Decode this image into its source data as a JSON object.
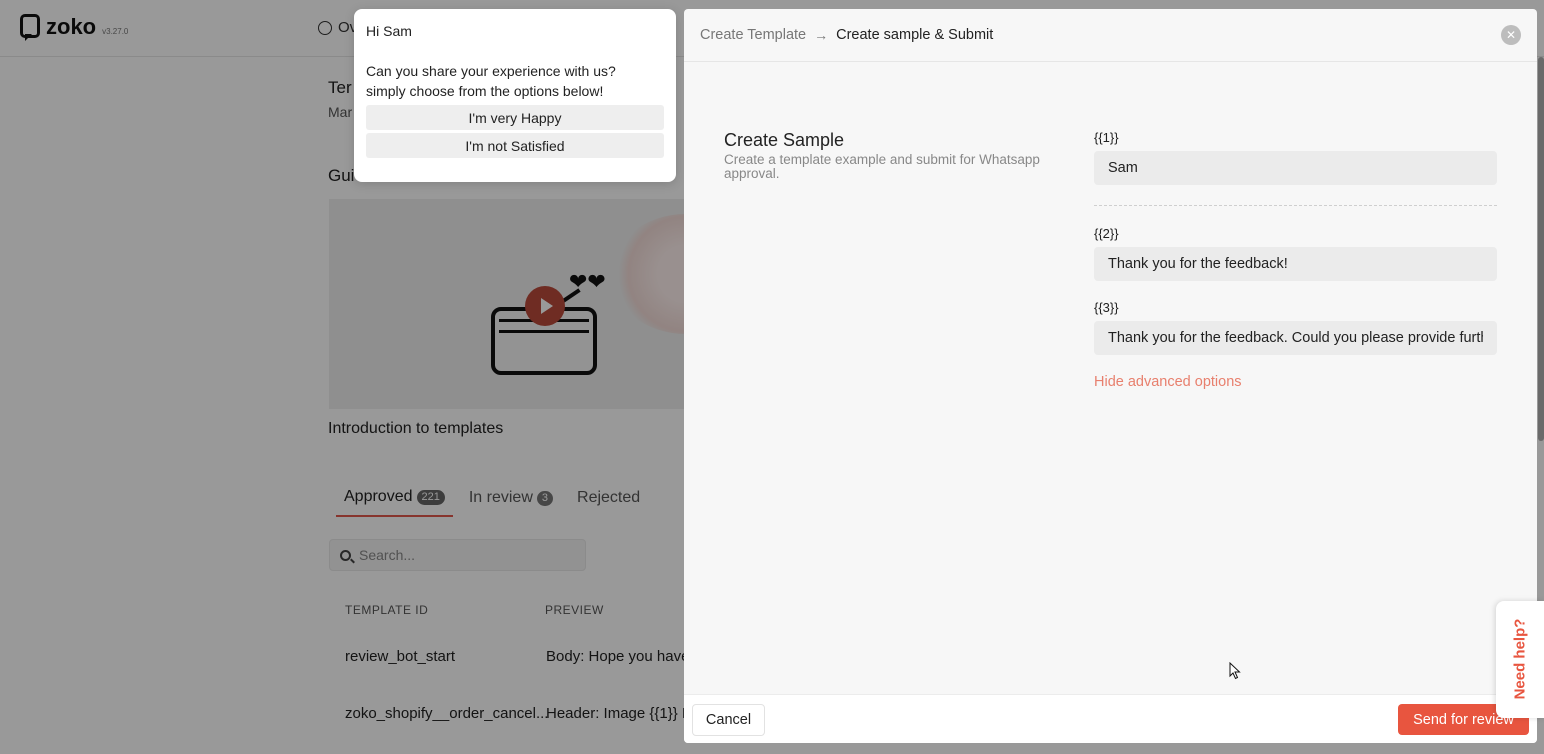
{
  "app": {
    "logo_text": "zoko",
    "version": "v3.27.0",
    "top_tab_label": "Ov",
    "page_title": "Ter",
    "page_subtitle": "Mar",
    "guide_label": "Gui",
    "video_caption": "Introduction to templates",
    "tabs": [
      {
        "label": "Approved",
        "count": "221"
      },
      {
        "label": "In review",
        "count": "3"
      },
      {
        "label": "Rejected",
        "count": ""
      }
    ],
    "search": {
      "placeholder": "Search..."
    },
    "table": {
      "headers": [
        "TEMPLATE ID",
        "PREVIEW"
      ],
      "rows": [
        [
          "review_bot_start",
          "Body: Hope you have"
        ],
        [
          "zoko_shopify__order_cancel...",
          "Header: Image {{1}} B"
        ]
      ]
    }
  },
  "popup": {
    "greeting": "Hi Sam",
    "message_line1": "Can you share your experience with us?",
    "message_line2": "simply choose from the options below!",
    "options": [
      "I'm very Happy",
      "I'm not Satisfied"
    ]
  },
  "drawer": {
    "breadcrumb": {
      "step1": "Create Template",
      "arrow": "→",
      "step2": "Create sample & Submit"
    },
    "close_glyph": "✕",
    "sample_title": "Create Sample",
    "sample_description": "Create a template example and submit for Whatsapp approval.",
    "variables": [
      {
        "label": "{{1}}",
        "value": "Sam"
      },
      {
        "label": "{{2}}",
        "value": "Thank you for the feedback!"
      },
      {
        "label": "{{3}}",
        "value": "Thank you for the feedback. Could you please provide further details"
      }
    ],
    "advanced_link": "Hide advanced options",
    "cancel_label": "Cancel",
    "submit_label": "Send for review"
  },
  "help": {
    "label": "Need help?"
  },
  "colors": {
    "accent": "#e8553f",
    "link": "#e8806e",
    "active_tab_underline": "#e2574c"
  },
  "icons": {
    "search": "search-icon",
    "close": "close-icon",
    "play": "play-icon",
    "radio_circle": "radio-circle-icon",
    "logo": "zoko-logo-icon",
    "cursor": "mouse-cursor-icon"
  }
}
